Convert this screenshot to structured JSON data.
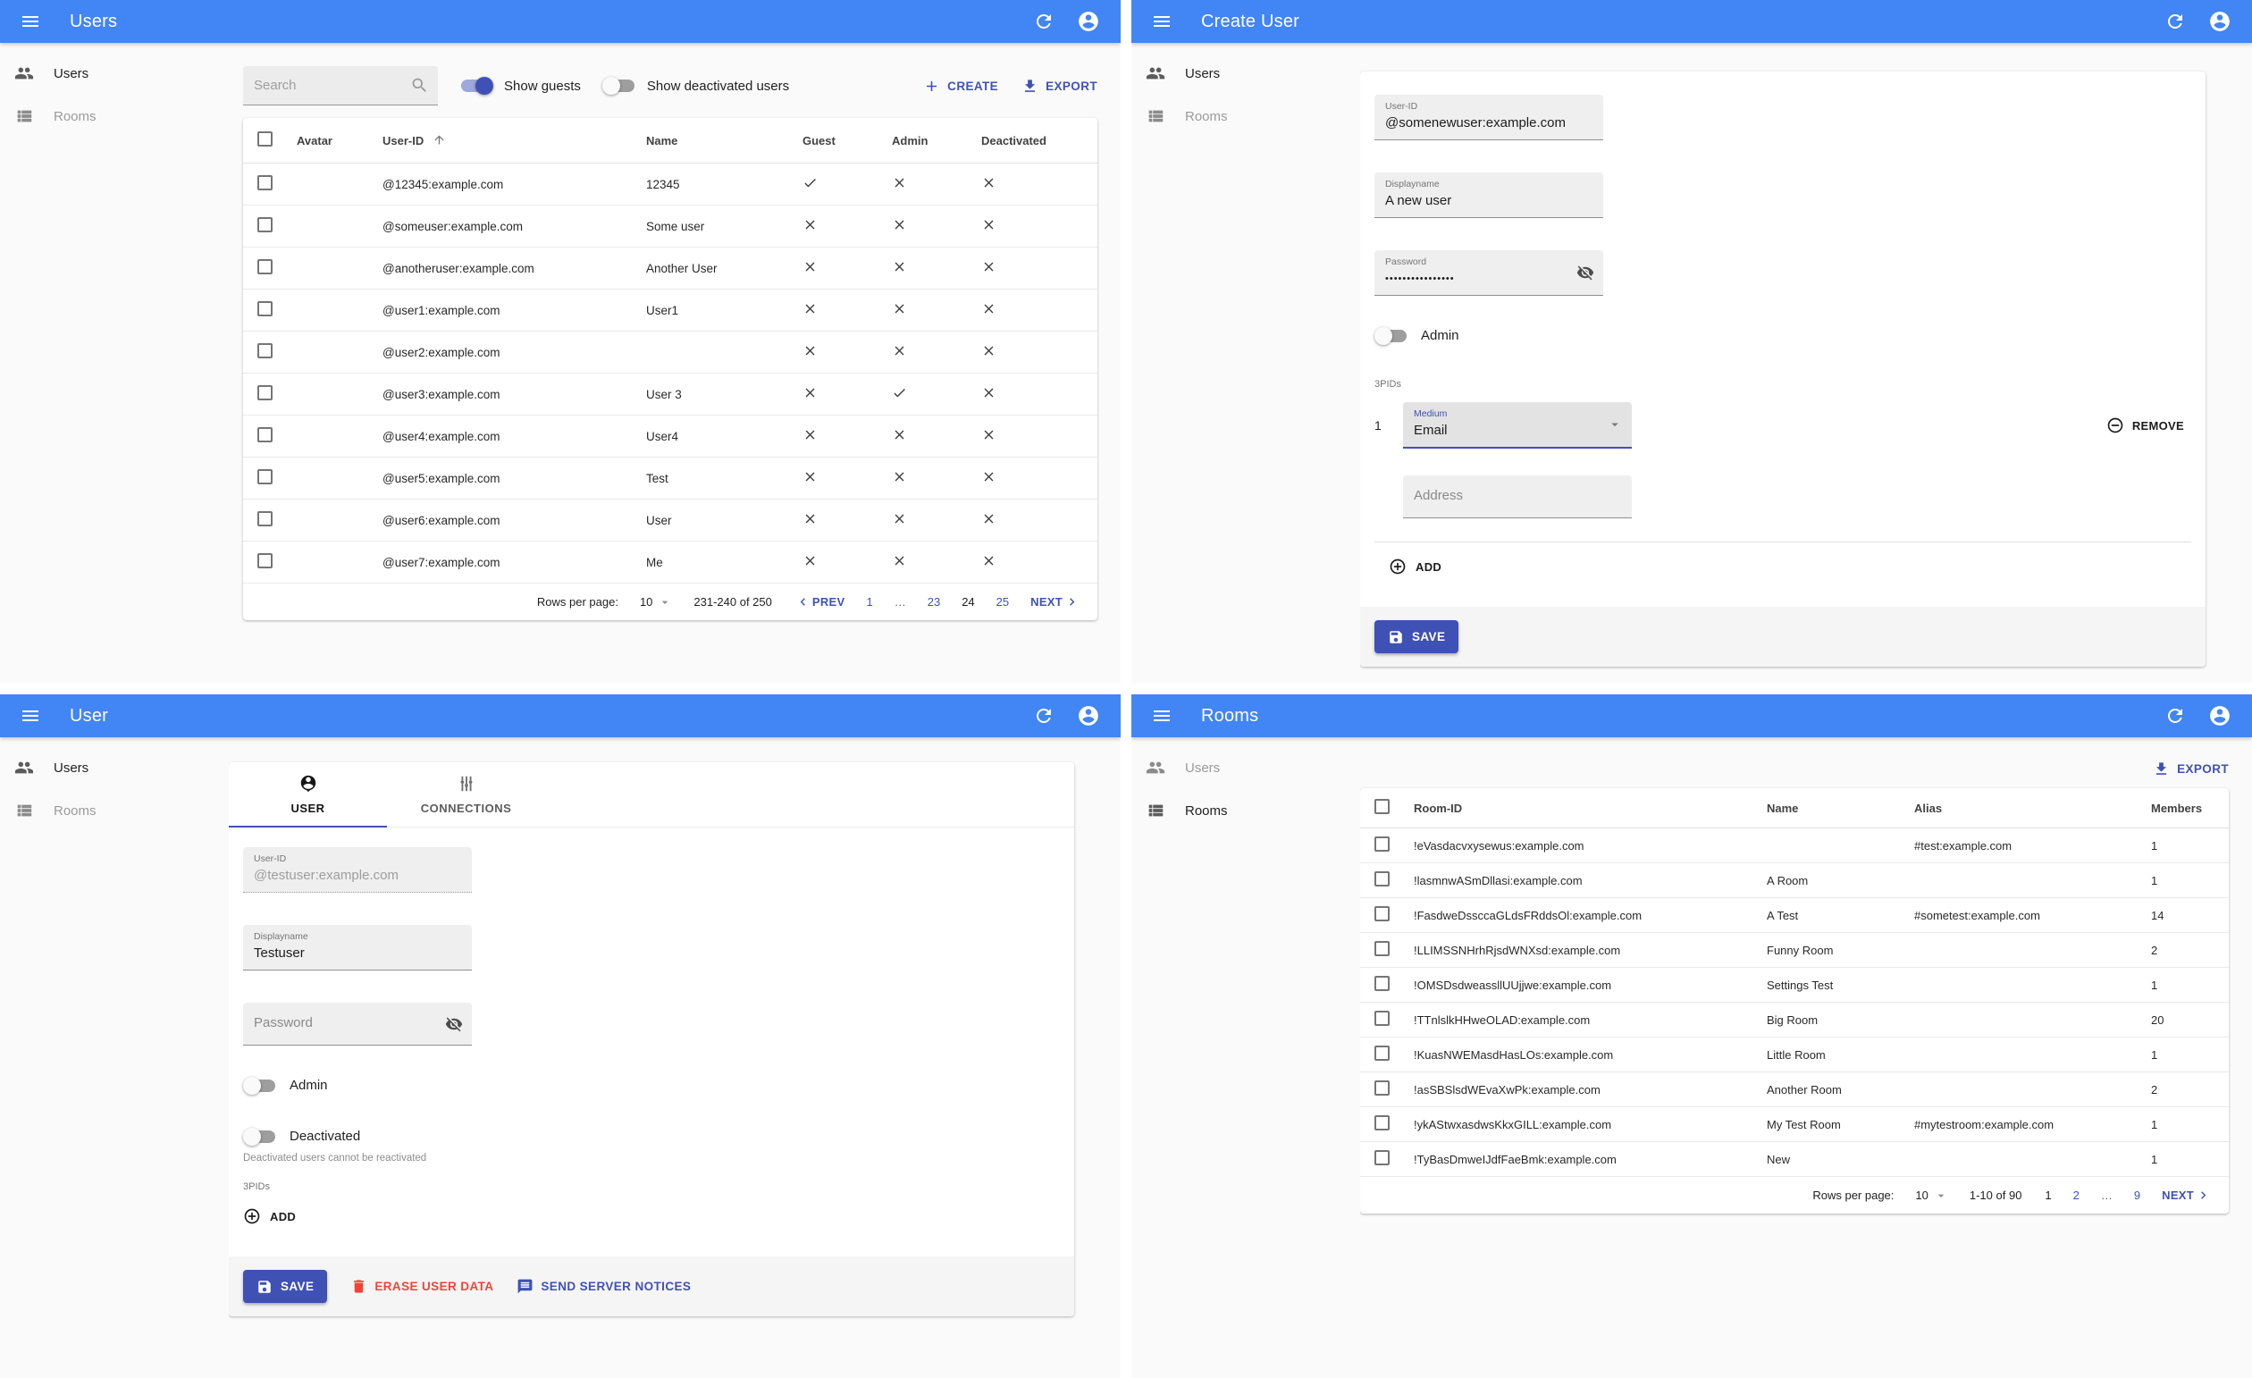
{
  "theme": {
    "appbar_color": "#4285f4",
    "primary_color": "#3f51b5",
    "danger_color": "#f44336",
    "background": "#fafafa"
  },
  "sidebar": {
    "users_label": "Users",
    "rooms_label": "Rooms"
  },
  "panels": {
    "users_list": {
      "title": "Users",
      "search_placeholder": "Search",
      "show_guests_label": "Show guests",
      "show_guests_on": true,
      "show_deactivated_label": "Show deactivated users",
      "show_deactivated_on": false,
      "create_label": "CREATE",
      "export_label": "EXPORT",
      "table": {
        "columns": [
          {
            "key": "avatar",
            "label": "Avatar"
          },
          {
            "key": "user_id",
            "label": "User-ID",
            "sorted": "asc"
          },
          {
            "key": "name",
            "label": "Name"
          },
          {
            "key": "guest",
            "label": "Guest",
            "type": "bool"
          },
          {
            "key": "admin",
            "label": "Admin",
            "type": "bool"
          },
          {
            "key": "deactivated",
            "label": "Deactivated",
            "type": "bool"
          }
        ],
        "rows": [
          {
            "avatar": "",
            "user_id": "@12345:example.com",
            "name": "12345",
            "guest": true,
            "admin": false,
            "deactivated": false
          },
          {
            "avatar": "",
            "user_id": "@someuser:example.com",
            "name": "Some user",
            "guest": false,
            "admin": false,
            "deactivated": false
          },
          {
            "avatar": "",
            "user_id": "@anotheruser:example.com",
            "name": "Another User",
            "guest": false,
            "admin": false,
            "deactivated": false
          },
          {
            "avatar": "",
            "user_id": "@user1:example.com",
            "name": "User1",
            "guest": false,
            "admin": false,
            "deactivated": false
          },
          {
            "avatar": "",
            "user_id": "@user2:example.com",
            "name": "",
            "guest": false,
            "admin": false,
            "deactivated": false
          },
          {
            "avatar": "",
            "user_id": "@user3:example.com",
            "name": "User 3",
            "guest": false,
            "admin": true,
            "deactivated": false
          },
          {
            "avatar": "",
            "user_id": "@user4:example.com",
            "name": "User4",
            "guest": false,
            "admin": false,
            "deactivated": false
          },
          {
            "avatar": "",
            "user_id": "@user5:example.com",
            "name": "Test",
            "guest": false,
            "admin": false,
            "deactivated": false
          },
          {
            "avatar": "",
            "user_id": "@user6:example.com",
            "name": "User",
            "guest": false,
            "admin": false,
            "deactivated": false
          },
          {
            "avatar": "",
            "user_id": "@user7:example.com",
            "name": "Me",
            "guest": false,
            "admin": false,
            "deactivated": false
          }
        ]
      },
      "pagination": {
        "rows_per_page_label": "Rows per page:",
        "rows_per_page": "10",
        "range": "231-240 of 250",
        "prev_label": "PREV",
        "next_label": "NEXT",
        "pages": [
          {
            "label": "1",
            "type": "link"
          },
          {
            "label": "…",
            "type": "ellipsis"
          },
          {
            "label": "23",
            "type": "link"
          },
          {
            "label": "24",
            "type": "current"
          },
          {
            "label": "25",
            "type": "link"
          }
        ]
      }
    },
    "create_user": {
      "title": "Create User",
      "user_id_label": "User-ID",
      "user_id_value": "@somenewuser:example.com",
      "displayname_label": "Displayname",
      "displayname_value": "A new user",
      "password_label": "Password",
      "password_value": "••••••••••••••••",
      "admin_label": "Admin",
      "admin_on": false,
      "threepids_label": "3PIDs",
      "threepid_index": "1",
      "medium_label": "Medium",
      "medium_value": "Email",
      "remove_label": "REMOVE",
      "address_placeholder": "Address",
      "add_label": "ADD",
      "save_label": "SAVE"
    },
    "user_edit": {
      "title": "User",
      "tab_user_label": "USER",
      "tab_connections_label": "CONNECTIONS",
      "user_id_label": "User-ID",
      "user_id_value": "@testuser:example.com",
      "displayname_label": "Displayname",
      "displayname_value": "Testuser",
      "password_placeholder": "Password",
      "admin_label": "Admin",
      "admin_on": false,
      "deactivated_label": "Deactivated",
      "deactivated_on": false,
      "deactivated_helper": "Deactivated users cannot be reactivated",
      "threepids_label": "3PIDs",
      "add_label": "ADD",
      "save_label": "SAVE",
      "erase_label": "ERASE USER DATA",
      "notices_label": "SEND SERVER NOTICES"
    },
    "rooms_list": {
      "title": "Rooms",
      "export_label": "EXPORT",
      "table": {
        "columns": [
          {
            "key": "room_id",
            "label": "Room-ID"
          },
          {
            "key": "name",
            "label": "Name"
          },
          {
            "key": "alias",
            "label": "Alias"
          },
          {
            "key": "members",
            "label": "Members"
          }
        ],
        "rows": [
          {
            "room_id": "!eVasdacvxysewus:example.com",
            "name": "",
            "alias": "#test:example.com",
            "members": "1"
          },
          {
            "room_id": "!lasmnwASmDllasi:example.com",
            "name": "A Room",
            "alias": "",
            "members": "1"
          },
          {
            "room_id": "!FasdweDssccaGLdsFRddsOl:example.com",
            "name": "A Test",
            "alias": "#sometest:example.com",
            "members": "14"
          },
          {
            "room_id": "!LLIMSSNHrhRjsdWNXsd:example.com",
            "name": "Funny Room",
            "alias": "",
            "members": "2"
          },
          {
            "room_id": "!OMSDsdweassllUUjjwe:example.com",
            "name": "Settings Test",
            "alias": "",
            "members": "1"
          },
          {
            "room_id": "!TTnlslkHHweOLAD:example.com",
            "name": "Big Room",
            "alias": "",
            "members": "20"
          },
          {
            "room_id": "!KuasNWEMasdHasLOs:example.com",
            "name": "Little Room",
            "alias": "",
            "members": "1"
          },
          {
            "room_id": "!asSBSlsdWEvaXwPk:example.com",
            "name": "Another Room",
            "alias": "",
            "members": "2"
          },
          {
            "room_id": "!ykAStwxasdwsKkxGILL:example.com",
            "name": "My Test Room",
            "alias": "#mytestroom:example.com",
            "members": "1"
          },
          {
            "room_id": "!TyBasDmweIJdfFaeBmk:example.com",
            "name": "New",
            "alias": "",
            "members": "1"
          }
        ]
      },
      "pagination": {
        "rows_per_page_label": "Rows per page:",
        "rows_per_page": "10",
        "range": "1-10 of 90",
        "next_label": "NEXT",
        "pages": [
          {
            "label": "1",
            "type": "current"
          },
          {
            "label": "2",
            "type": "link"
          },
          {
            "label": "…",
            "type": "ellipsis"
          },
          {
            "label": "9",
            "type": "link"
          }
        ]
      }
    }
  }
}
